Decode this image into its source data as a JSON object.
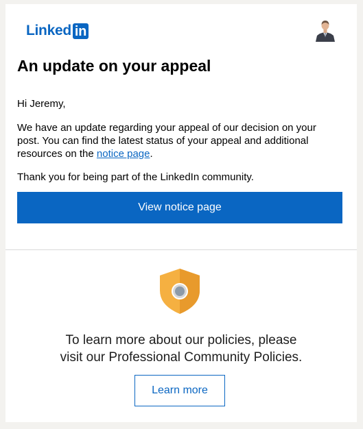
{
  "header": {
    "logo_text": "Linked",
    "logo_in": "in",
    "avatar_icon": "profile-photo"
  },
  "email": {
    "title": "An update on your appeal",
    "greeting": "Hi Jeremy,",
    "para1_before_link": "We have an update regarding your appeal of our decision on your post. You can find the latest status of your appeal and additional resources on the ",
    "para1_link": "notice page",
    "para1_after_link": ".",
    "para2": "Thank you for being part of the LinkedIn community.",
    "cta_label": "View notice page"
  },
  "policies": {
    "icon": "shield-icon",
    "text_line1": "To learn more about our policies, please",
    "text_line2": "visit our Professional Community Policies.",
    "button_label": "Learn more"
  },
  "colors": {
    "brand_blue": "#0a66c2",
    "shield_gold": "#f5b041",
    "page_bg": "#f3f2ef"
  }
}
